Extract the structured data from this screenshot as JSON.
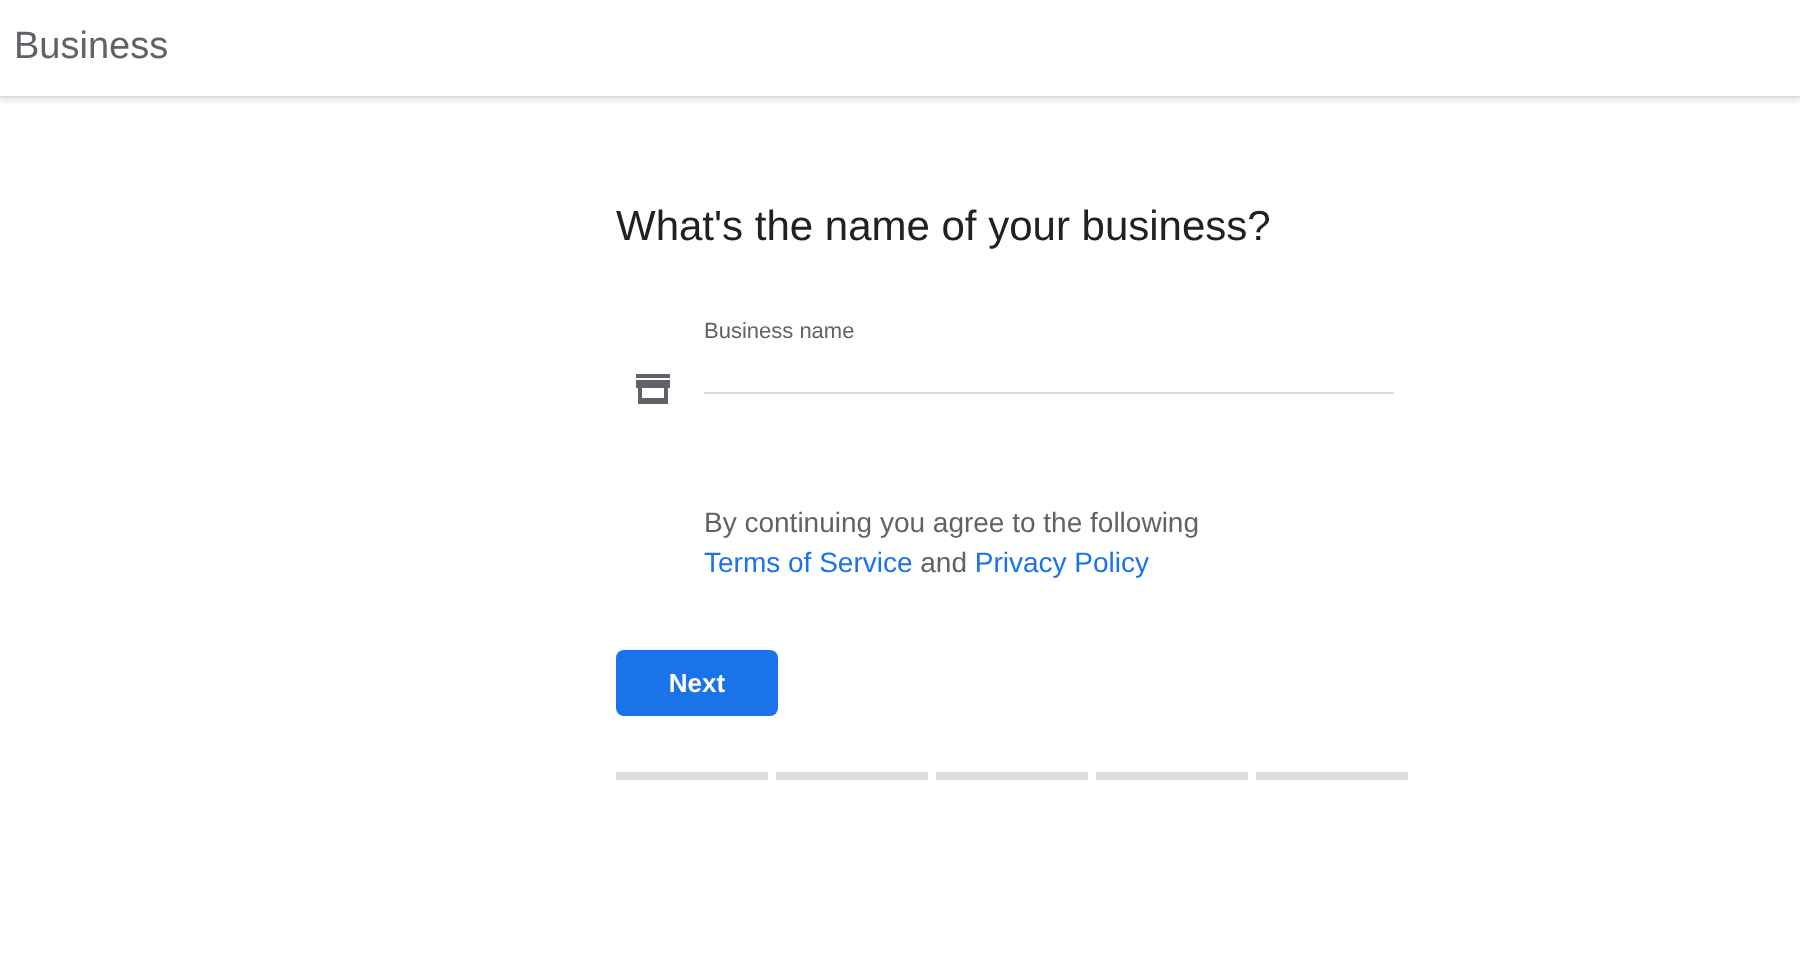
{
  "header": {
    "title": "Business"
  },
  "heading": "What's the name of your business?",
  "field": {
    "label": "Business name"
  },
  "consent": {
    "before": "By continuing you agree to the following ",
    "links": [
      "Terms of Service",
      "Privacy Policy"
    ],
    "joiner": " and "
  },
  "button": "Next",
  "steps": [
    {
      "done": false
    },
    {
      "done": false
    },
    {
      "done": false
    },
    {
      "done": false
    },
    {
      "done": false
    }
  ]
}
